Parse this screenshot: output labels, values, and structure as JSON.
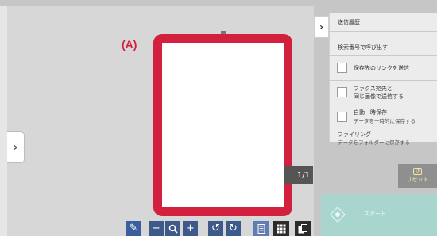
{
  "preview": {
    "label_a": "(A)",
    "page_indicator": "1/1"
  },
  "right_menu": {
    "items": [
      {
        "label": "送信履歴"
      },
      {
        "label": "検索番号で呼び出す"
      },
      {
        "label": "保存先のリンクを送信",
        "checked": false
      },
      {
        "label": "ファクス宛先と",
        "label2": "同じ画像で送信する",
        "checked": false
      },
      {
        "label": "自動一時保存",
        "sub": "データを一時的に保存する",
        "checked": false
      },
      {
        "label": "ファイリング",
        "sub": "データをフォルダーに保存する"
      }
    ]
  },
  "reset": {
    "label": "リセット"
  },
  "start": {
    "label": "スタート"
  },
  "toolbar": {
    "zoom_out": "−",
    "zoom_in": "+"
  },
  "colors": {
    "highlight": "#d3203f",
    "start_panel": "#a8d6cf",
    "toolbar_blue": "#3d5a8a"
  }
}
